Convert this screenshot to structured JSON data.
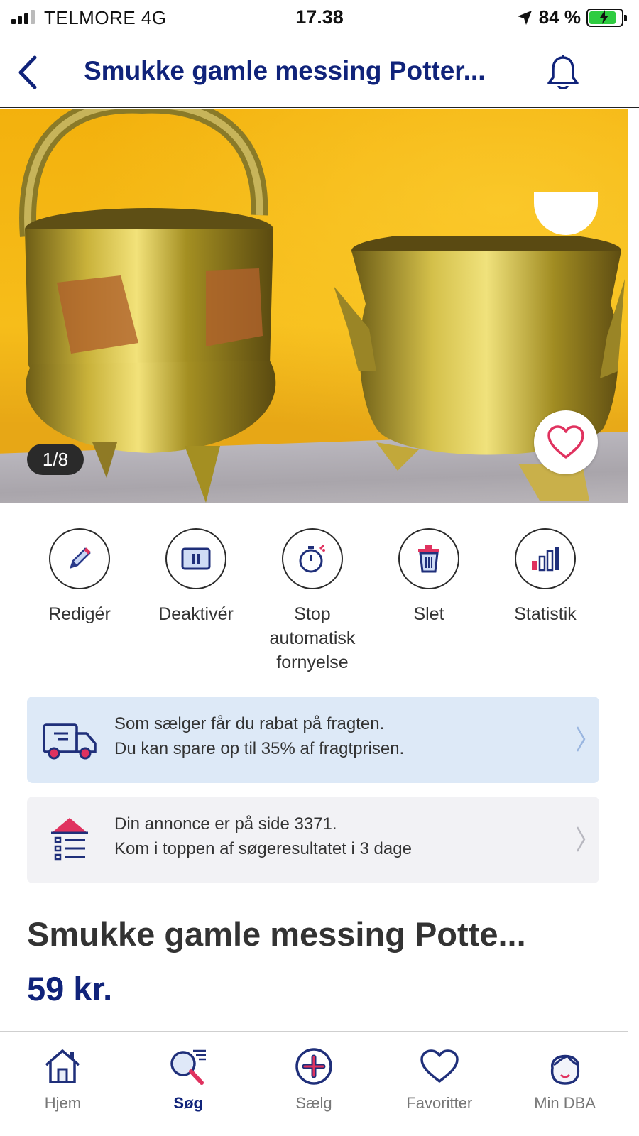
{
  "status_bar": {
    "carrier": "TELMORE  4G",
    "time": "17.38",
    "battery_percent": "84 %"
  },
  "header": {
    "title": "Smukke gamle messing Potter..."
  },
  "gallery": {
    "counter": "1/8"
  },
  "actions": [
    {
      "label": "Redigér",
      "icon": "pencil-icon"
    },
    {
      "label": "Deaktivér",
      "icon": "pause-icon"
    },
    {
      "label": "Stop automatisk fornyelse",
      "icon": "stopwatch-icon"
    },
    {
      "label": "Slet",
      "icon": "trash-icon"
    },
    {
      "label": "Statistik",
      "icon": "bar-chart-icon"
    }
  ],
  "shipping_card": {
    "line1": "Som sælger får du rabat på fragten.",
    "line2": "Du kan spare op til 35% af fragtprisen."
  },
  "rank_card": {
    "line1": "Din annonce er på side 3371.",
    "line2": "Kom i toppen af søgeresultatet i 3 dage"
  },
  "listing": {
    "title": "Smukke gamle messing Potte...",
    "price": "59 kr."
  },
  "tabs": [
    {
      "label": "Hjem",
      "icon": "home-icon",
      "active": false
    },
    {
      "label": "Søg",
      "icon": "search-icon",
      "active": true
    },
    {
      "label": "Sælg",
      "icon": "plus-circle-icon",
      "active": false
    },
    {
      "label": "Favoritter",
      "icon": "heart-icon",
      "active": false
    },
    {
      "label": "Min DBA",
      "icon": "profile-icon",
      "active": false
    }
  ],
  "colors": {
    "brand_navy": "#10237a",
    "accent_pink": "#e0325f",
    "shipping_card_bg": "#dde9f7"
  }
}
